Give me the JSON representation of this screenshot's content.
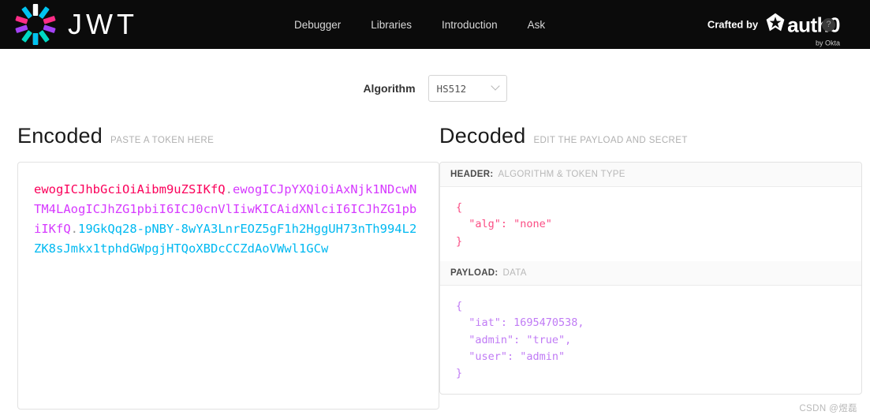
{
  "navbar": {
    "brand_text": "JWT",
    "logo_icon": "jwt-burst-logo",
    "links": [
      {
        "label": "Debugger"
      },
      {
        "label": "Libraries"
      },
      {
        "label": "Introduction"
      },
      {
        "label": "Ask"
      }
    ],
    "crafted_by_label": "Crafted by",
    "auth0_word": "auth0",
    "auth0_icon": "auth0-shield-icon",
    "by_okta": "by Okta",
    "help_icon": "help-question-icon",
    "help_glyph": "?"
  },
  "algorithm": {
    "label": "Algorithm",
    "selected": "HS512",
    "chevron_icon": "chevron-down-icon"
  },
  "encoded": {
    "title": "Encoded",
    "subtitle": "PASTE A TOKEN HERE",
    "token": {
      "header": "ewogICJhbGciOiAibm9uZSIKfQ",
      "payload": "ewogICJpYXQiOiAxNjk1NDcwNTM4LAogICJhZG1pbiI6ICJ0cnVlIiwKICAidXNlciI6ICJhZG1pbiIKfQ",
      "signature": "19GkQq28-pNBY-8wYA3LnrEOZ5gF1h2HggUH73nTh994L2ZK8sJmkx1tphdGWpgjHTQoXBDcCCZdAoVWwl1GCw",
      "separator": "."
    }
  },
  "decoded": {
    "title": "Decoded",
    "subtitle": "EDIT THE PAYLOAD AND SECRET",
    "header_section": {
      "label": "HEADER:",
      "sub": "ALGORITHM & TOKEN TYPE",
      "code": "{\n  \"alg\": \"none\"\n}"
    },
    "payload_section": {
      "label": "PAYLOAD:",
      "sub": "DATA",
      "code": "{\n  \"iat\": 1695470538,\n  \"admin\": \"true\",\n  \"user\": \"admin\"\n}"
    }
  },
  "watermark": "CSDN @煜磊",
  "colors": {
    "navbar_bg": "#0b0b0b",
    "header_segment": "#fb015b",
    "payload_segment": "#d63aff",
    "signature_segment": "#00b9f1",
    "code_header": "#fb4d84",
    "code_payload": "#c07bf5"
  }
}
